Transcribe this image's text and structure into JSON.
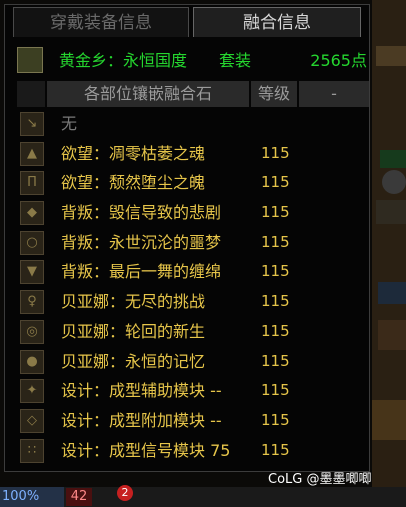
{
  "tabs": [
    {
      "label": "穿戴装备信息",
      "active": false
    },
    {
      "label": "融合信息",
      "active": true
    }
  ],
  "set_info": {
    "name": "黄金乡：永恒国度",
    "type": "套装",
    "points": "2565点",
    "icon": "set-armor-icon"
  },
  "table": {
    "headers": [
      "各部位镶嵌融合石",
      "等级",
      "-"
    ],
    "rows": [
      {
        "icon": "empty-slot-icon",
        "name": "无",
        "level": ""
      },
      {
        "icon": "armor-chest-icon",
        "name": "欲望：凋零枯萎之魂",
        "level": "115"
      },
      {
        "icon": "armor-legs-icon",
        "name": "欲望：颓然堕尘之魄",
        "level": "115"
      },
      {
        "icon": "armor-shoulder-icon",
        "name": "背叛：毁信导致的悲剧",
        "level": "115"
      },
      {
        "icon": "armor-belt-icon",
        "name": "背叛：永世沉沦的噩梦",
        "level": "115"
      },
      {
        "icon": "armor-boots-icon",
        "name": "背叛：最后一舞的缠绵",
        "level": "115"
      },
      {
        "icon": "necklace-icon",
        "name": "贝亚娜：无尽的挑战",
        "level": "115"
      },
      {
        "icon": "bracelet-icon",
        "name": "贝亚娜：轮回的新生",
        "level": "115"
      },
      {
        "icon": "ring-icon",
        "name": "贝亚娜：永恒的记忆",
        "level": "115"
      },
      {
        "icon": "assist-gear-icon",
        "name": "设计：成型辅助模块 --",
        "level": "115"
      },
      {
        "icon": "magic-stone-icon",
        "name": "设计：成型附加模块 --",
        "level": "115"
      },
      {
        "icon": "earring-icon",
        "name": "设计：成型信号模块 75",
        "level": "115"
      }
    ]
  },
  "watermark": "CoLG @墨墨唧唧",
  "bottom": {
    "percent": "100%",
    "level": "42",
    "notification_count": "2"
  },
  "colors": {
    "gold": "#e6c54a",
    "green": "#25d62f",
    "grey": "#7a7a7a"
  }
}
